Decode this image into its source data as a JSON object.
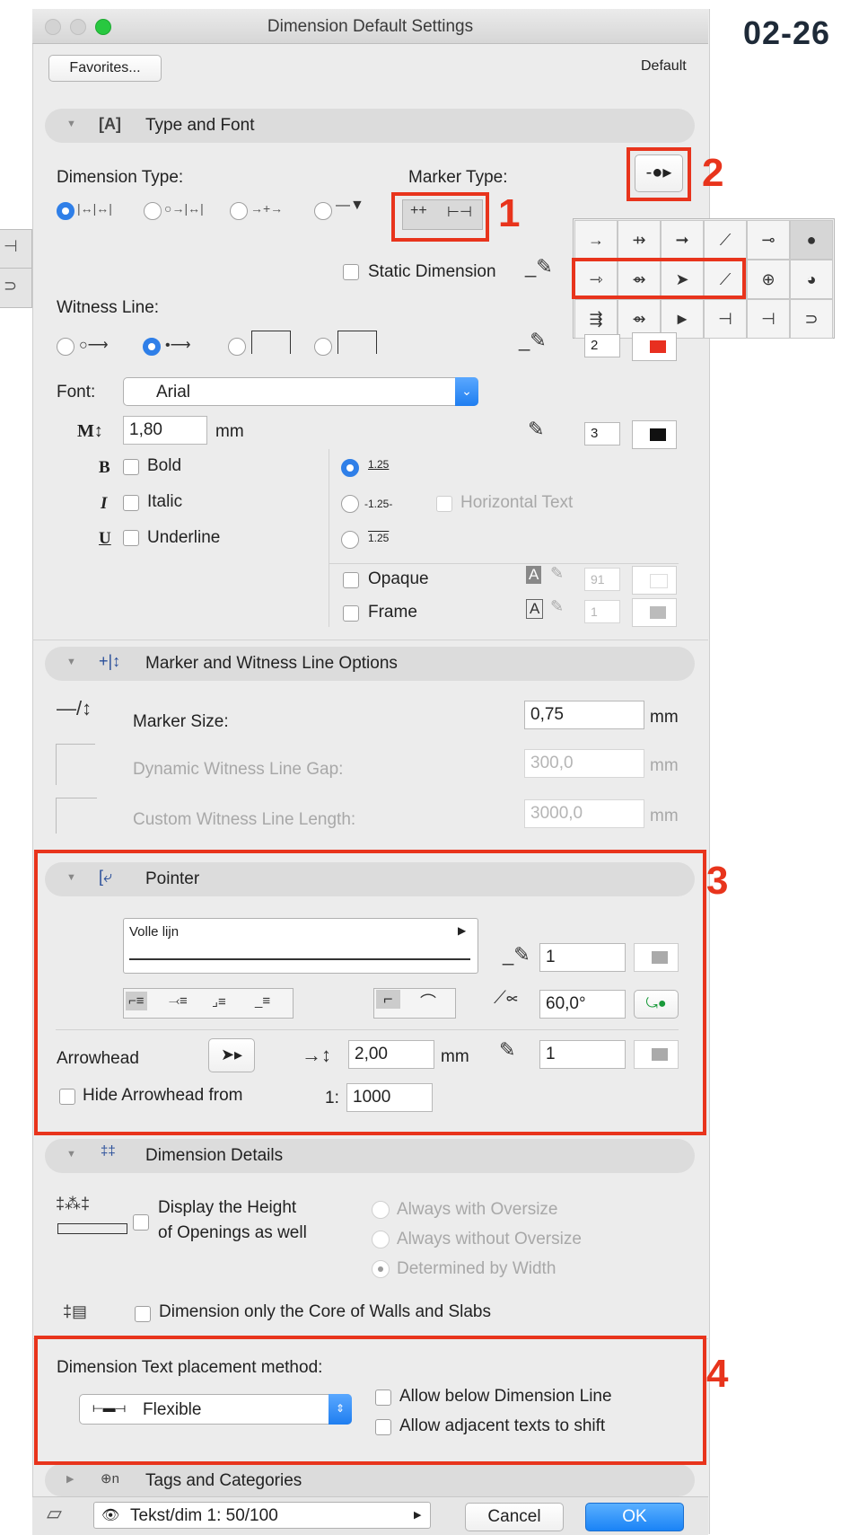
{
  "window": {
    "title": "Dimension Default Settings"
  },
  "corner_label": "02-26",
  "header": {
    "favorites_label": "Favorites...",
    "default_label": "Default"
  },
  "type_font": {
    "section_title": "Type and Font",
    "dimension_type_label": "Dimension Type:",
    "marker_type_label": "Marker Type:",
    "static_dimension_label": "Static Dimension",
    "witness_line_label": "Witness Line:",
    "witness_pen": "2",
    "font_label": "Font:",
    "font_value": "Arial",
    "size_value": "1,80",
    "size_unit": "mm",
    "text_pen": "3",
    "text_style_glyph": "1.25",
    "bold_label": "Bold",
    "italic_label": "Italic",
    "underline_label": "Underline",
    "horizontal_text_label": "Horizontal Text",
    "opaque_label": "Opaque",
    "opaque_pen": "91",
    "frame_label": "Frame",
    "frame_pen": "1",
    "placement_samples": [
      "1.25",
      "-1.25-",
      "1.25"
    ]
  },
  "marker_popup": {
    "rows": [
      [
        "→",
        "⇸",
        "➞",
        "⟋",
        "⊸",
        "●"
      ],
      [
        "⇾",
        "⇴",
        "➤",
        "⟋",
        "⊕",
        "◕"
      ],
      [
        "⇶",
        "⇴",
        "►",
        "⊣",
        "⊣",
        "⊃"
      ]
    ]
  },
  "marker_options": {
    "section_title": "Marker and Witness Line Options",
    "marker_size_label": "Marker Size:",
    "marker_size_value": "0,75",
    "gap_label": "Dynamic Witness Line Gap:",
    "gap_value": "300,0",
    "length_label": "Custom Witness Line Length:",
    "length_value": "3000,0",
    "unit": "mm"
  },
  "pointer": {
    "section_title": "Pointer",
    "line_type": "Volle lijn",
    "line_pen": "1",
    "angle_value": "60,0°",
    "arrowhead_label": "Arrowhead",
    "arrow_size": "2,00",
    "unit": "mm",
    "arrow_pen": "1",
    "hide_label": "Hide Arrowhead from",
    "scale_prefix": "1:",
    "scale_value": "1000"
  },
  "details": {
    "section_title": "Dimension Details",
    "display_height_label_1": "Display the Height",
    "display_height_label_2": "of Openings as well",
    "always_with": "Always with Oversize",
    "always_without": "Always without Oversize",
    "determined": "Determined by Width",
    "core_label": "Dimension only the Core of Walls and Slabs",
    "placement_label": "Dimension Text placement method:",
    "placement_value": "Flexible",
    "allow_below": "Allow below Dimension Line",
    "allow_shift": "Allow adjacent texts to shift"
  },
  "tags": {
    "section_title": "Tags and Categories"
  },
  "footer": {
    "layer_value": "Tekst/dim 1: 50/100",
    "cancel_label": "Cancel",
    "ok_label": "OK"
  },
  "annotations": [
    "1",
    "2",
    "3",
    "4"
  ],
  "colors": {
    "accent_blue": "#2f7fe8",
    "annotation_red": "#e8341c",
    "window_bg": "#ececec"
  }
}
